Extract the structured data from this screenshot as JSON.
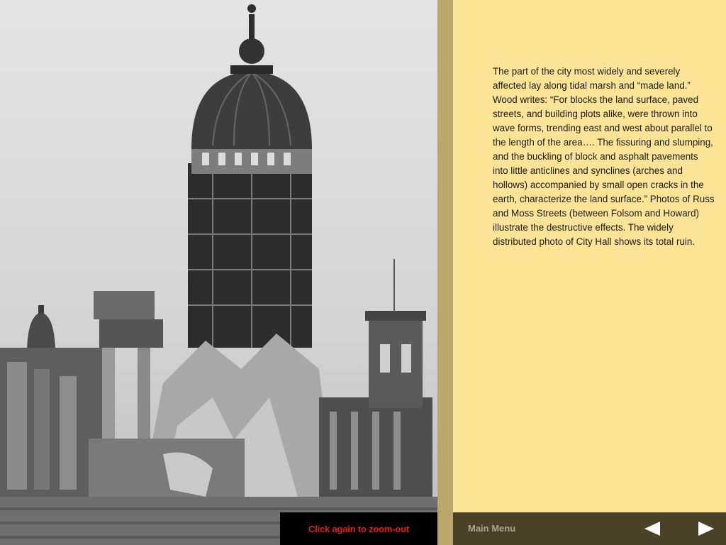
{
  "photo": {
    "subject": "City Hall ruins"
  },
  "article": {
    "paragraph": "The part of the city most widely and severely affected lay along tidal marsh and “made land.” Wood writes: “For blocks the land surface, paved streets, and building plots alike, were thrown into wave forms, trending east and west about parallel to the length of the area…. The fissuring and slumping, and the buckling of block and asphalt pavements into little anticlines and synclines (arches and hollows) accompanied by small open cracks in the earth, characterize the land surface.” Photos of Russ and Moss Streets (between Folsom and Howard) illustrate the destructive effects. The widely distributed photo of City Hall shows its total ruin."
  },
  "zoom": {
    "label": "Click again to zoom-out"
  },
  "nav": {
    "menu_label": "Main Menu",
    "prev_icon": "left-arrow-icon",
    "next_icon": "right-arrow-icon"
  },
  "colors": {
    "panel_bg": "#fde396",
    "divider": "#b9a86a",
    "nav_bg": "#4a4228",
    "zoom_text": "#e31b1b"
  }
}
